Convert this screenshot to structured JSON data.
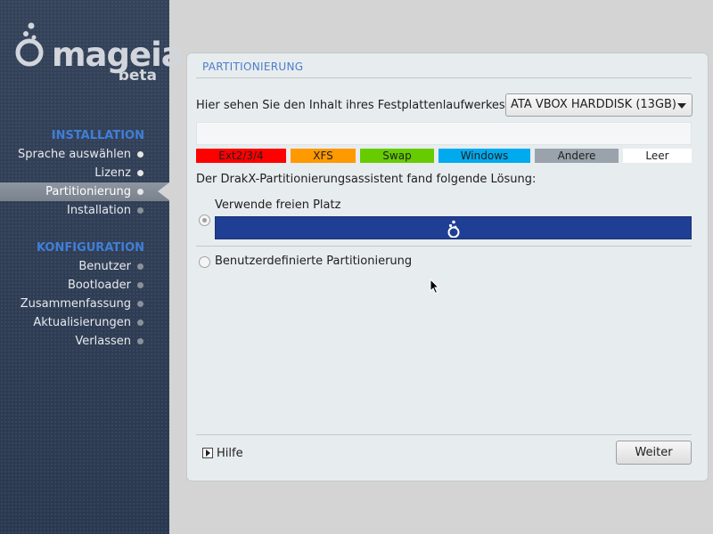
{
  "brand": {
    "name": "mageia",
    "subtitle": "beta",
    "logo_icon": "mageia-cauldron-icon"
  },
  "sidebar": {
    "sections": [
      {
        "title": "INSTALLATION",
        "items": [
          {
            "label": "Sprache auswählen",
            "state": "done"
          },
          {
            "label": "Lizenz",
            "state": "done"
          },
          {
            "label": "Partitionierung",
            "state": "active"
          },
          {
            "label": "Installation",
            "state": "pending"
          }
        ]
      },
      {
        "title": "KONFIGURATION",
        "items": [
          {
            "label": "Benutzer",
            "state": "pending"
          },
          {
            "label": "Bootloader",
            "state": "pending"
          },
          {
            "label": "Zusammenfassung",
            "state": "pending"
          },
          {
            "label": "Aktualisierungen",
            "state": "pending"
          },
          {
            "label": "Verlassen",
            "state": "pending"
          }
        ]
      }
    ]
  },
  "main": {
    "title": "PARTITIONIERUNG",
    "disk_prompt": "Hier sehen Sie den Inhalt ihres Festplattenlaufwerkes",
    "disk_select": {
      "value": "ATA VBOX HARDDISK (13GB)",
      "icon": "chevron-down-icon"
    },
    "legend": [
      {
        "label": "Ext2/3/4",
        "color": "#ff0000"
      },
      {
        "label": "XFS",
        "color": "#ff9900"
      },
      {
        "label": "Swap",
        "color": "#66cc00"
      },
      {
        "label": "Windows",
        "color": "#00aaee"
      },
      {
        "label": "Andere",
        "color": "#9aa3ab"
      },
      {
        "label": "Leer",
        "color": "#ffffff"
      }
    ],
    "solution_text": "Der DrakX-Partitionierungsassistent fand folgende Lösung:",
    "options": [
      {
        "label": "Verwende freien Platz",
        "selected": true
      },
      {
        "label": "Benutzerdefinierte Partitionierung",
        "selected": false
      }
    ],
    "free_space_color": "#1f3f94",
    "help_label": "Hilfe",
    "next_label": "Weiter"
  }
}
